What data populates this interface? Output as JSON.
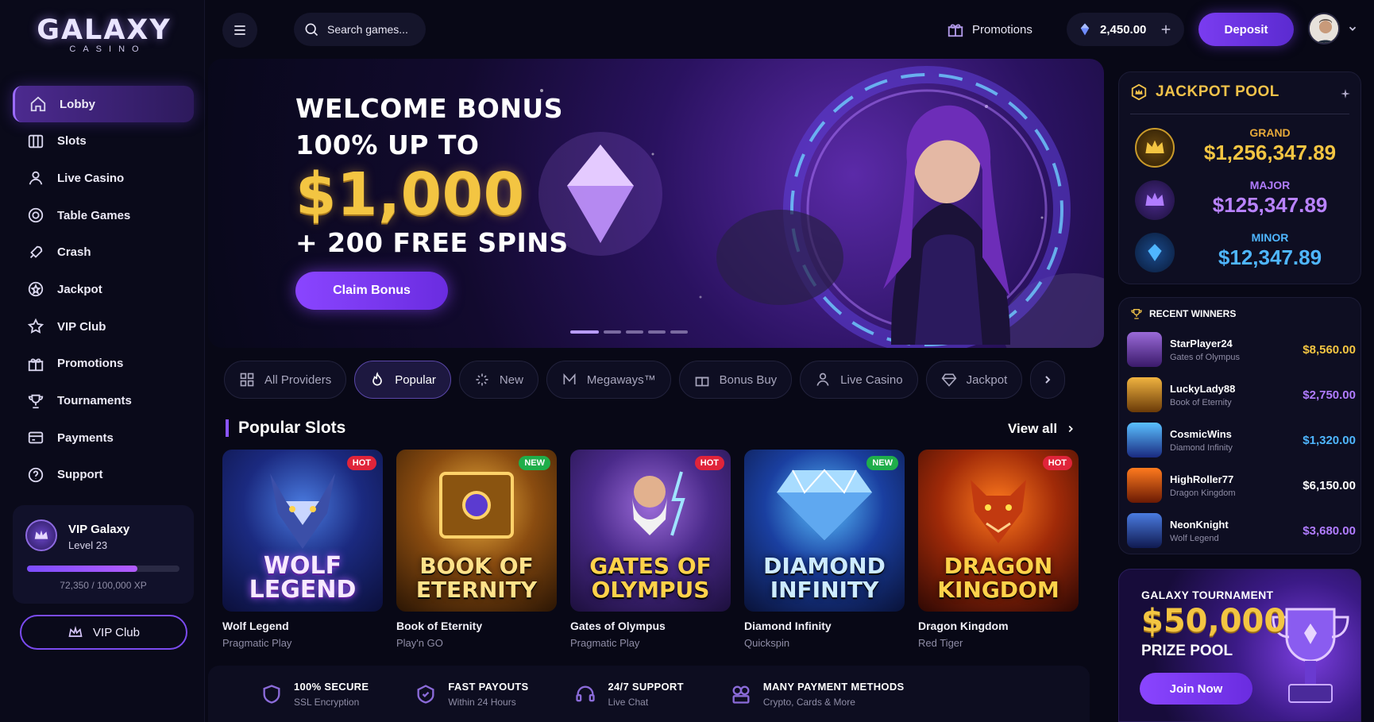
{
  "brand": {
    "name": "GALAXY",
    "sub": "CASINO"
  },
  "sidebar": {
    "items": [
      {
        "label": "Lobby",
        "icon": "home-icon"
      },
      {
        "label": "Slots",
        "icon": "slots-icon"
      },
      {
        "label": "Live Casino",
        "icon": "live-casino-icon"
      },
      {
        "label": "Table Games",
        "icon": "chip-icon"
      },
      {
        "label": "Crash",
        "icon": "rocket-icon"
      },
      {
        "label": "Jackpot",
        "icon": "jackpot-icon"
      },
      {
        "label": "VIP Club",
        "icon": "star-icon"
      },
      {
        "label": "Promotions",
        "icon": "gift-icon"
      },
      {
        "label": "Tournaments",
        "icon": "trophy-icon"
      },
      {
        "label": "Payments",
        "icon": "wallet-icon"
      },
      {
        "label": "Support",
        "icon": "help-icon"
      }
    ],
    "vip": {
      "title": "VIP Galaxy",
      "level": "Level 23",
      "xp": "72,350 / 100,000 XP",
      "progress": 0.7235
    },
    "vip_button": "VIP Club"
  },
  "header": {
    "search_placeholder": "Search games...",
    "promotions": "Promotions",
    "balance": "2,450.00",
    "deposit": "Deposit"
  },
  "hero": {
    "line1": "WELCOME BONUS",
    "line2": "100% UP TO",
    "amount": "$1,000",
    "line3": "+ 200 FREE SPINS",
    "cta": "Claim Bonus"
  },
  "chips": [
    "All Providers",
    "Popular",
    "New",
    "Megaways™",
    "Bonus Buy",
    "Live Casino",
    "Jackpot"
  ],
  "popular": {
    "title": "Popular Slots",
    "view_all": "View all",
    "games": [
      {
        "name": "Wolf Legend",
        "provider": "Pragmatic Play",
        "badge": "HOT",
        "art": "WOLF LEGEND"
      },
      {
        "name": "Book of Eternity",
        "provider": "Play'n GO",
        "badge": "NEW",
        "art": "BOOK OF ETERNITY"
      },
      {
        "name": "Gates of Olympus",
        "provider": "Pragmatic Play",
        "badge": "HOT",
        "art": "GATES OF OLYMPUS"
      },
      {
        "name": "Diamond Infinity",
        "provider": "Quickspin",
        "badge": "NEW",
        "art": "DIAMOND INFINITY"
      },
      {
        "name": "Dragon Kingdom",
        "provider": "Red Tiger",
        "badge": "HOT",
        "art": "DRAGON KINGDOM"
      }
    ]
  },
  "features": [
    {
      "title": "100% SECURE",
      "sub": "SSL Encryption"
    },
    {
      "title": "FAST PAYOUTS",
      "sub": "Within 24 Hours"
    },
    {
      "title": "24/7 SUPPORT",
      "sub": "Live Chat"
    },
    {
      "title": "MANY PAYMENT METHODS",
      "sub": "Crypto, Cards & More"
    }
  ],
  "jackpot": {
    "title": "JACKPOT POOL",
    "tiers": [
      {
        "label": "GRAND",
        "amount": "$1,256,347.89",
        "color": "#f3c542"
      },
      {
        "label": "MAJOR",
        "amount": "$125,347.89",
        "color": "#b07cff"
      },
      {
        "label": "MINOR",
        "amount": "$12,347.89",
        "color": "#4fb6ff"
      }
    ]
  },
  "winners": {
    "title": "RECENT WINNERS",
    "rows": [
      {
        "user": "StarPlayer24",
        "game": "Gates of Olympus",
        "amount": "$8,560.00",
        "color": "#f3c542"
      },
      {
        "user": "LuckyLady88",
        "game": "Book of Eternity",
        "amount": "$2,750.00",
        "color": "#b07cff"
      },
      {
        "user": "CosmicWins",
        "game": "Diamond Infinity",
        "amount": "$1,320.00",
        "color": "#4fb6ff"
      },
      {
        "user": "HighRoller77",
        "game": "Dragon Kingdom",
        "amount": "$6,150.00",
        "color": "#ffffff"
      },
      {
        "user": "NeonKnight",
        "game": "Wolf Legend",
        "amount": "$3,680.00",
        "color": "#b07cff"
      }
    ]
  },
  "tournament": {
    "title": "GALAXY TOURNAMENT",
    "amount": "$50,000",
    "sub": "PRIZE POOL",
    "cta": "Join Now"
  },
  "colors": {
    "accent": "#7a3cf0",
    "gold": "#f3c542",
    "hot": "#e0243a",
    "new": "#1fae4a"
  }
}
